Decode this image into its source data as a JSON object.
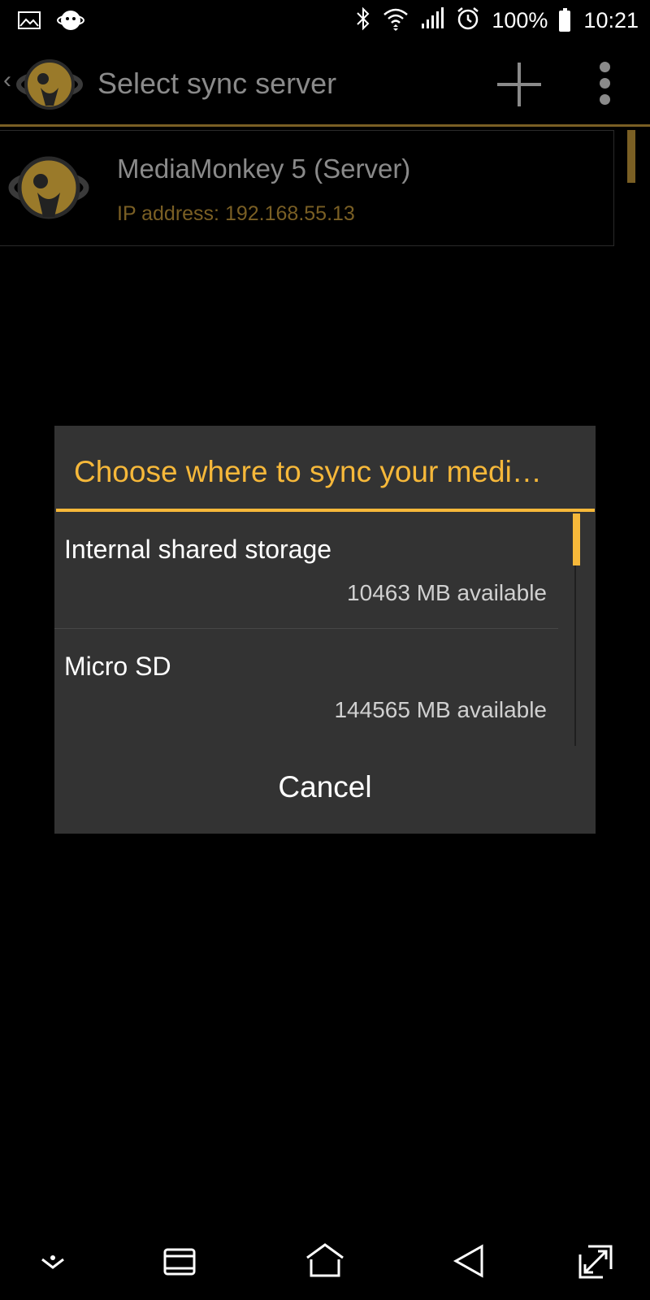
{
  "status_bar": {
    "battery": "100%",
    "time": "10:21",
    "icons": [
      "gallery-icon",
      "mediamonkey-notification-icon",
      "bluetooth-icon",
      "wifi-icon",
      "cell-signal-icon",
      "alarm-icon",
      "battery-icon"
    ]
  },
  "app_bar": {
    "title": "Select sync server",
    "icons": [
      "back-chevron-icon",
      "mediamonkey-logo",
      "add-icon",
      "more-vert-icon"
    ]
  },
  "servers": [
    {
      "name": "MediaMonkey 5 (Server)",
      "ip": "IP address: 192.168.55.13"
    }
  ],
  "dialog": {
    "title": "Choose where to sync your medi…",
    "options": [
      {
        "name": "Internal shared storage",
        "available": "10463 MB available"
      },
      {
        "name": "Micro SD",
        "available": "144565 MB available"
      }
    ],
    "cancel_label": "Cancel"
  },
  "nav_bar": {
    "icons": [
      "hide-nav-icon",
      "recents-icon",
      "home-icon",
      "back-icon",
      "screenshot-icon"
    ]
  },
  "colors": {
    "accent": "#f6b83a",
    "accent_dim": "#7a5f24",
    "dialog_bg": "#333333",
    "background": "#000000"
  }
}
